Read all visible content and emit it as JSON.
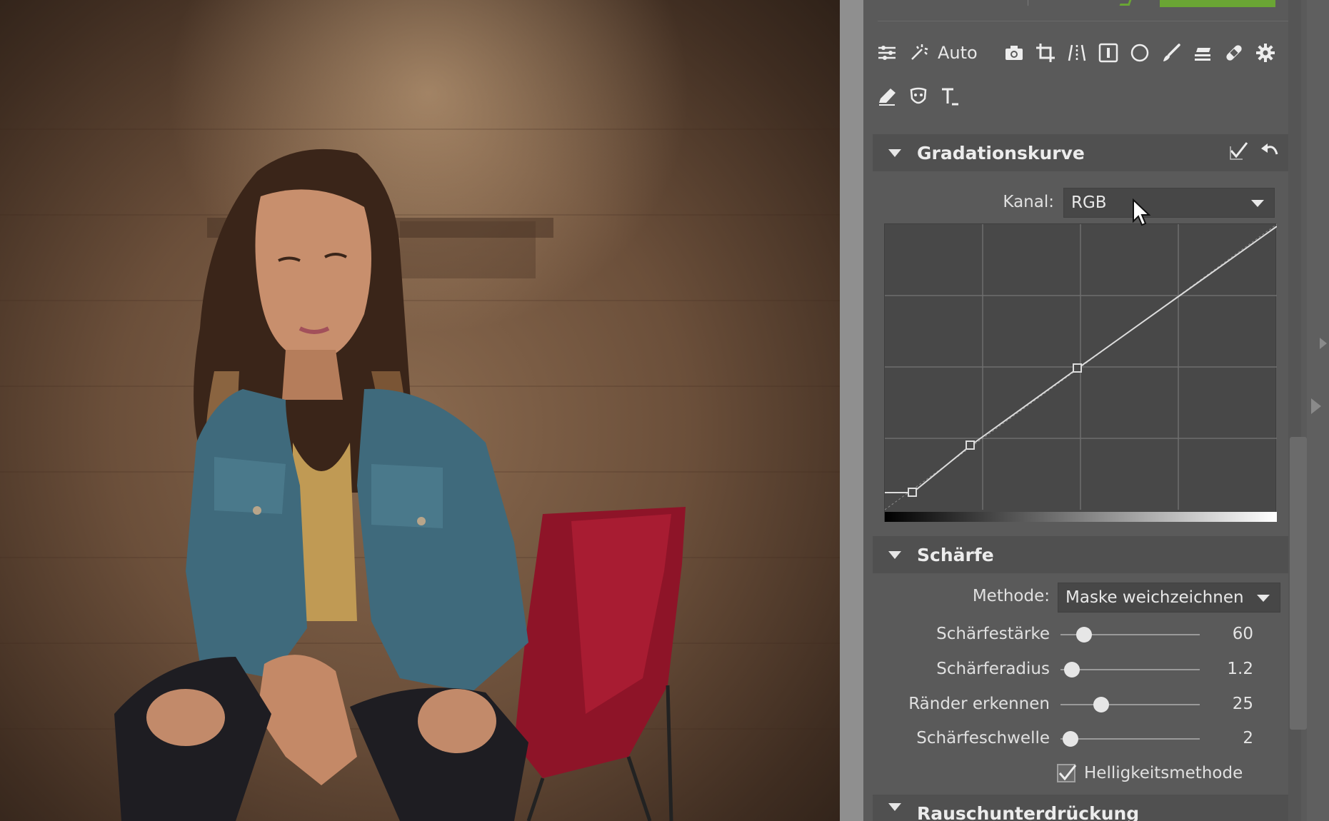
{
  "toolbar": {
    "auto_label": "Auto",
    "icons": [
      "sliders-icon",
      "magic-wand-icon",
      "camera-icon",
      "crop-icon",
      "perspective-icon",
      "exposure-icon",
      "circle-icon",
      "brush-icon",
      "gradient-icon",
      "bandage-icon",
      "gear-icon",
      "eraser-icon",
      "mask-icon",
      "text-icon"
    ]
  },
  "curve_section": {
    "title": "Gradationskurve",
    "channel_label": "Kanal:",
    "channel_value": "RGB",
    "enabled": true
  },
  "sharpen_section": {
    "title": "Schärfe",
    "method_label": "Methode:",
    "method_value": "Maske weichzeichnen",
    "sliders": [
      {
        "label": "Schärfestärke",
        "value": "60",
        "level": 0.17
      },
      {
        "label": "Schärferadius",
        "value": "1.2",
        "level": 0.08
      },
      {
        "label": "Ränder erkennen",
        "value": "25",
        "level": 0.29
      },
      {
        "label": "Schärfeschwelle",
        "value": "2",
        "level": 0.07
      }
    ],
    "luminance_label": "Helligkeitsmethode",
    "luminance_checked": true
  },
  "noise_section": {
    "title": "Rauschunterdrückung"
  },
  "colors": {
    "panel": "#5a5a5a",
    "accent_green": "#6aa534"
  }
}
